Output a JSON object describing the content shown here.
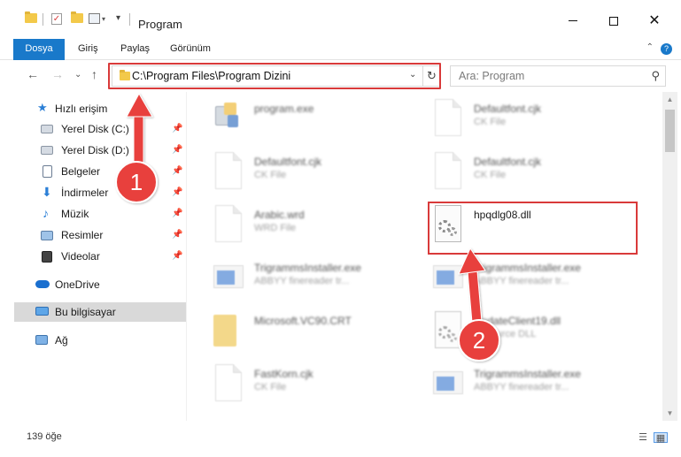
{
  "window": {
    "title": "Program",
    "buttons": {
      "minimize": "minimize",
      "maximize": "maximize",
      "close": "✕"
    }
  },
  "ribbon": {
    "tabs": [
      "Dosya",
      "Giriş",
      "Paylaş",
      "Görünüm"
    ],
    "help": "?",
    "collapse": "⌃"
  },
  "nav": {
    "back": "←",
    "forward": "→",
    "recent": "⌄",
    "up": "↑",
    "address": "C:\\Program Files\\Program Dizini",
    "address_dropdown": "⌄",
    "refresh": "↻",
    "search_placeholder": "Ara: Program",
    "search_icon": "⚲"
  },
  "sidebar": {
    "quick_access": "Hızlı erişim",
    "items": [
      {
        "label": "Yerel Disk (C:)",
        "icon": "drive-icon"
      },
      {
        "label": "Yerel Disk (D:)",
        "icon": "drive-icon"
      },
      {
        "label": "Belgeler",
        "icon": "documents-icon"
      },
      {
        "label": "İndirmeler",
        "icon": "downloads-icon"
      },
      {
        "label": "Müzik",
        "icon": "music-icon"
      },
      {
        "label": "Resimler",
        "icon": "pictures-icon"
      },
      {
        "label": "Videolar",
        "icon": "videos-icon"
      }
    ],
    "onedrive": "OneDrive",
    "this_pc": "Bu bilgisayar",
    "network": "Ağ"
  },
  "files": [
    {
      "name": "program.exe",
      "type": "",
      "icon": "exe"
    },
    {
      "name": "Defaultfont.cjk",
      "type": "CK File",
      "icon": "doc"
    },
    {
      "name": "Defaultfont.cjk",
      "type": "CK File",
      "icon": "doc"
    },
    {
      "name": "Defaultfont.cjk",
      "type": "CK File",
      "icon": "doc"
    },
    {
      "name": "Arabic.wrd",
      "type": "WRD File",
      "icon": "doc"
    },
    {
      "name": "hpqdlg08.dll",
      "type": "",
      "icon": "dll"
    },
    {
      "name": "TrigrammsInstaller.exe",
      "type": "ABBYY finereader tr...",
      "icon": "app"
    },
    {
      "name": "TrigrammsInstaller.exe",
      "type": "ABBYY finereader tr...",
      "icon": "app"
    },
    {
      "name": "Microsoft.VC90.CRT",
      "type": "",
      "icon": "folder"
    },
    {
      "name": "UpdateClient19.dll",
      "type": "Resource DLL",
      "icon": "dll"
    },
    {
      "name": "FastKorn.cjk",
      "type": "CK File",
      "icon": "doc"
    },
    {
      "name": "TrigrammsInstaller.exe",
      "type": "ABBYY finereader tr...",
      "icon": "app"
    }
  ],
  "status": {
    "count": "139 öğe"
  },
  "annotations": {
    "step1": "1",
    "step2": "2",
    "color": "#e8413c"
  }
}
